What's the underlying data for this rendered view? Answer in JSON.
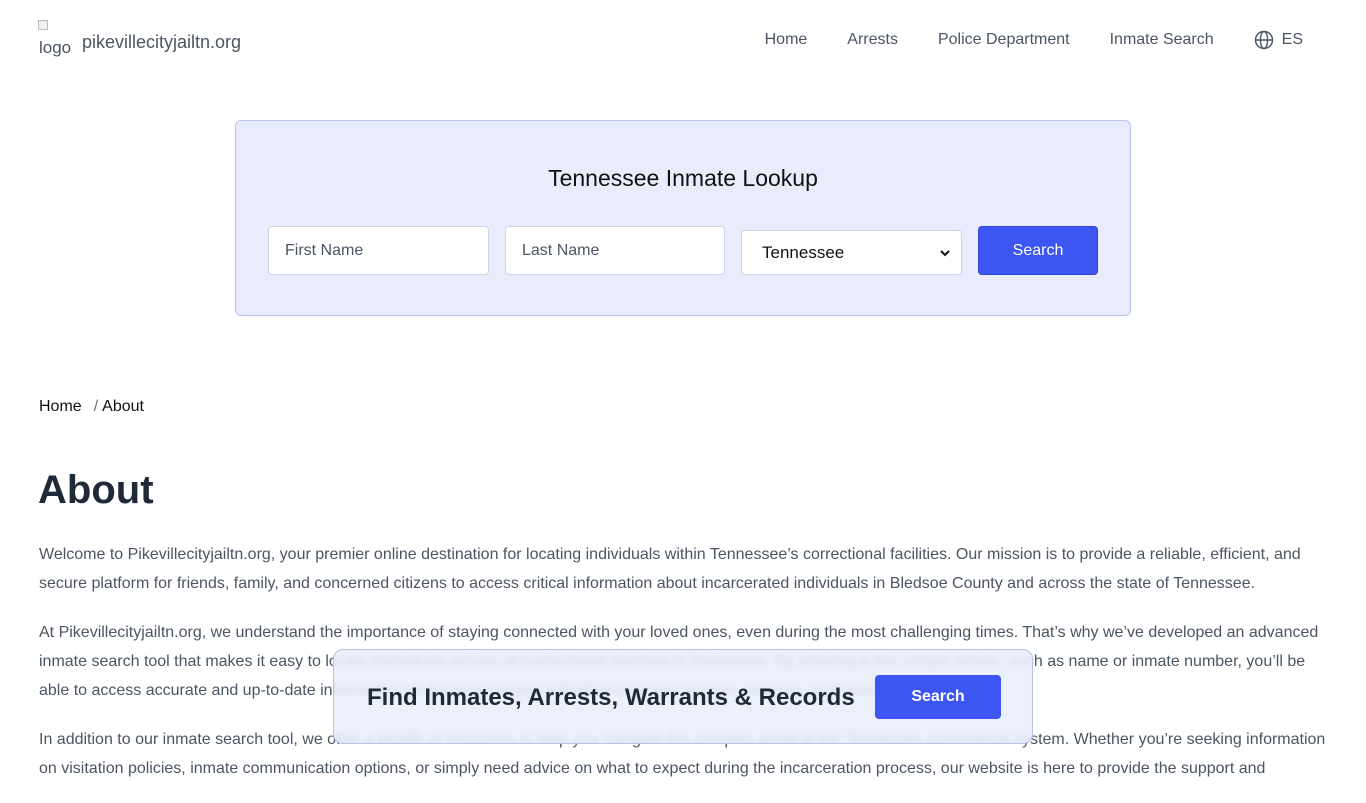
{
  "header": {
    "logo_alt": "logo",
    "site_name": "pikevillecityjailtn.org",
    "nav": [
      "Home",
      "Arrests",
      "Police Department",
      "Inmate Search"
    ],
    "language": "ES",
    "language_icon": "globe-icon"
  },
  "lookup": {
    "title": "Tennessee Inmate Lookup",
    "first_name_placeholder": "First Name",
    "last_name_placeholder": "Last Name",
    "state_selected": "Tennessee",
    "search_label": "Search"
  },
  "breadcrumb": {
    "home": "Home",
    "separator": "/",
    "current": "About"
  },
  "page": {
    "title": "About",
    "paragraphs": [
      "Welcome to Pikevillecityjailtn.org, your premier online destination for locating individuals within Tennessee’s correctional facilities. Our mission is to provide a reliable, efficient, and secure platform for friends, family, and concerned citizens to access critical information about incarcerated individuals in Bledsoe County and across the state of Tennessee.",
      "At Pikevillecityjailtn.org, we understand the importance of staying connected with your loved ones, even during the most challenging times. That’s why we’ve developed an advanced inmate search tool that makes it easy to locate individuals across all correctional facilities in Tennessee. By entering a few simple details, such as name or inmate number, you’ll be able to access accurate and up-to-date information on the incarcerated individual’s current location, charges, and more.",
      "In addition to our inmate search tool, we offer a wealth of resources to help you navigate the complex world of the Tennessee correctional system. Whether you’re seeking information on visitation policies, inmate communication options, or simply need advice on what to expect during the incarceration process, our website is here to provide the support and"
    ]
  },
  "sticky_bar": {
    "text": "Find Inmates, Arrests, Warrants & Records",
    "button_label": "Search"
  },
  "colors": {
    "accent": "#3d55f2",
    "panel_bg": "#e9ecfc",
    "panel_border": "#b8c0f0"
  }
}
